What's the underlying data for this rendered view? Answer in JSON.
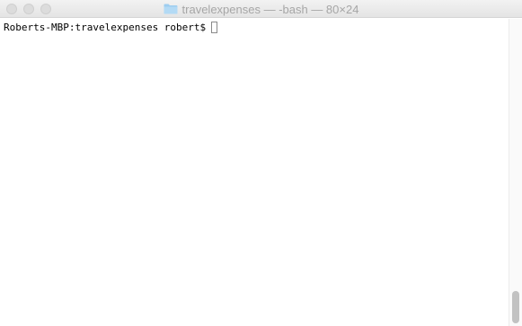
{
  "window": {
    "title": "travelexpenses — -bash — 80×24"
  },
  "icons": {
    "title_icon": "folder-icon"
  },
  "terminal": {
    "prompt": "Roberts-MBP:travelexpenses robert$"
  },
  "colors": {
    "title_text": "#a6a6a6",
    "folder": "#9dcdf0",
    "background": "#ffffff",
    "text": "#000000"
  }
}
